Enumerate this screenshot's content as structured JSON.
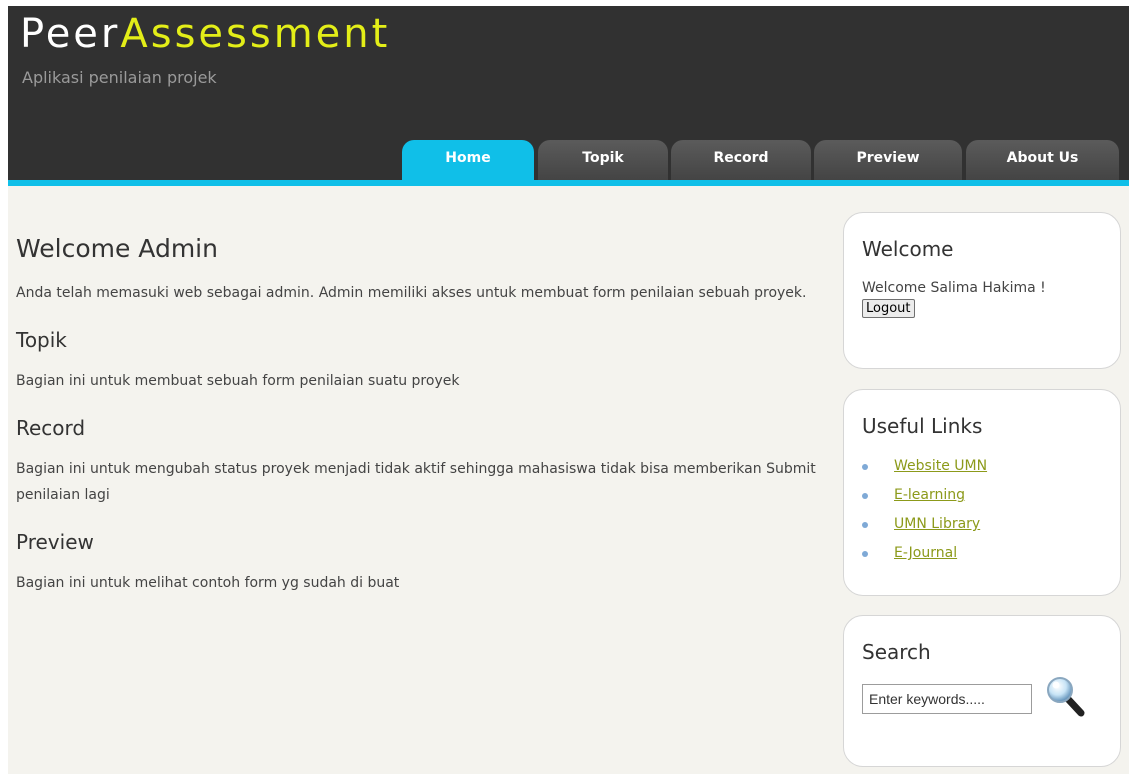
{
  "header": {
    "logo_part1": "Peer",
    "logo_part2": "Assessment",
    "slogan": "Aplikasi penilaian projek"
  },
  "nav": {
    "tabs": [
      {
        "label": "Home",
        "active": true
      },
      {
        "label": "Topik",
        "active": false
      },
      {
        "label": "Record",
        "active": false
      },
      {
        "label": "Preview",
        "active": false
      },
      {
        "label": "About Us",
        "active": false
      }
    ]
  },
  "main": {
    "title": "Welcome Admin",
    "intro": "Anda telah memasuki web sebagai admin. Admin memiliki akses untuk membuat form penilaian sebuah proyek.",
    "sections": [
      {
        "heading": "Topik",
        "text": "Bagian ini untuk membuat sebuah form penilaian suatu proyek"
      },
      {
        "heading": "Record",
        "text": "Bagian ini untuk mengubah status proyek menjadi tidak aktif sehingga mahasiswa tidak bisa memberikan Submit penilaian lagi"
      },
      {
        "heading": "Preview",
        "text": "Bagian ini untuk melihat contoh form yg sudah di buat"
      }
    ]
  },
  "sidebar": {
    "welcome": {
      "title": "Welcome",
      "text": "Welcome Salima Hakima !",
      "logout_label": "Logout"
    },
    "links": {
      "title": "Useful Links",
      "items": [
        {
          "label": "Website UMN"
        },
        {
          "label": "E-learning"
        },
        {
          "label": "UMN Library"
        },
        {
          "label": "E-Journal"
        }
      ]
    },
    "search": {
      "title": "Search",
      "placeholder": "Enter keywords.....",
      "icon": "magnifier-icon"
    }
  },
  "colors": {
    "header_bg": "#313131",
    "accent": "#10bfe8",
    "logo_highlight": "#e3ee18",
    "link": "#8c9a1a",
    "page_bg": "#f4f3ee"
  }
}
